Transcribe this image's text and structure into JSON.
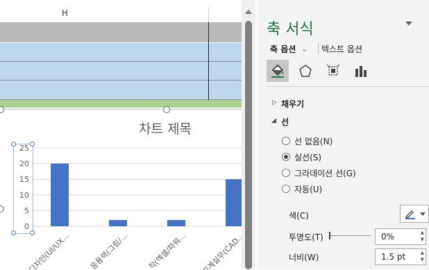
{
  "sheet": {
    "column_header": "H"
  },
  "chart_data": {
    "type": "bar",
    "title": "차트 제목",
    "categories": [
      "디자인(UI/UX...",
      "응용력(그림/...",
      "직(엑셀/파워...",
      "(회계실무(CAD..."
    ],
    "values": [
      20,
      2,
      2,
      15
    ],
    "ylim": [
      0,
      25
    ],
    "yticks": [
      "0",
      "5",
      "10",
      "15",
      "20",
      "25"
    ],
    "bar_color": "#4472c4"
  },
  "pane": {
    "title": "축 서식",
    "tab_axis_options": "축 옵션",
    "tab_text_options": "텍스트 옵션",
    "section_fill": "채우기",
    "section_line": "선",
    "radio_no_line": "선 없음(N)",
    "radio_solid": "실선(S)",
    "radio_gradient": "그라데이션 선(G)",
    "radio_auto": "자동(U)",
    "label_color": "색(C)",
    "label_transparency": "투명도(T)",
    "label_width": "너비(W)",
    "value_transparency": "0%",
    "value_width": "1.5 pt",
    "accent_color": "#217346"
  }
}
